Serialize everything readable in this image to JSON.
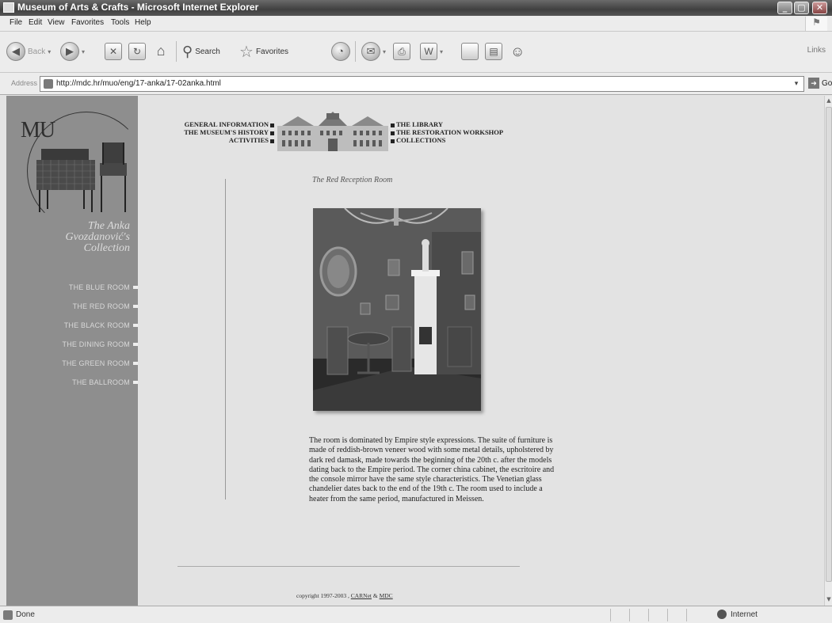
{
  "window": {
    "title": "Museum of Arts & Crafts - Microsoft Internet Explorer",
    "controls": [
      "_",
      "▢",
      "✕"
    ]
  },
  "menu": [
    "File",
    "Edit",
    "View",
    "Favorites",
    "Tools",
    "Help"
  ],
  "toolbar": {
    "back": "Back",
    "search": "Search",
    "favorites": "Favorites",
    "links": "Links"
  },
  "address": {
    "label": "Address",
    "url": "http://mdc.hr/muo/eng/17-anka/17-02anka.html",
    "go": "Go"
  },
  "sidebar": {
    "logo": "MU",
    "collection_lines": [
      "The Anka",
      "Gvozdanović's",
      "Collection"
    ],
    "rooms": [
      "THE BLUE ROOM",
      "THE RED ROOM",
      "THE BLACK ROOM",
      "THE DINING ROOM",
      "THE GREEN ROOM",
      "THE BALLROOM"
    ]
  },
  "nav": {
    "left": [
      "GENERAL INFORMATION",
      "THE MUSEUM'S HISTORY",
      "ACTIVITIES"
    ],
    "right": [
      "THE LIBRARY",
      "THE RESTORATION WORKSHOP",
      "COLLECTIONS"
    ]
  },
  "room": {
    "title": "The Red Reception Room",
    "description": "The room is dominated by Empire style expressions. The suite of furniture is made of reddish-brown veneer wood with some metal details, upholstered by dark red damask, made towards the beginning of the 20th c. after the models dating back to the Empire period. The corner china cabinet, the escritoire and the console mirror have the same style characteristics. The Venetian glass chandelier dates back to the end of the 19th c. The room used to include a heater from the same period, manufactured in Meissen."
  },
  "footer": {
    "copyright": "copyright 1997-2003 , ",
    "link1": "CARNet",
    "amp": " & ",
    "link2": "MDC"
  },
  "status": {
    "text": "Done",
    "zone": "Internet"
  }
}
